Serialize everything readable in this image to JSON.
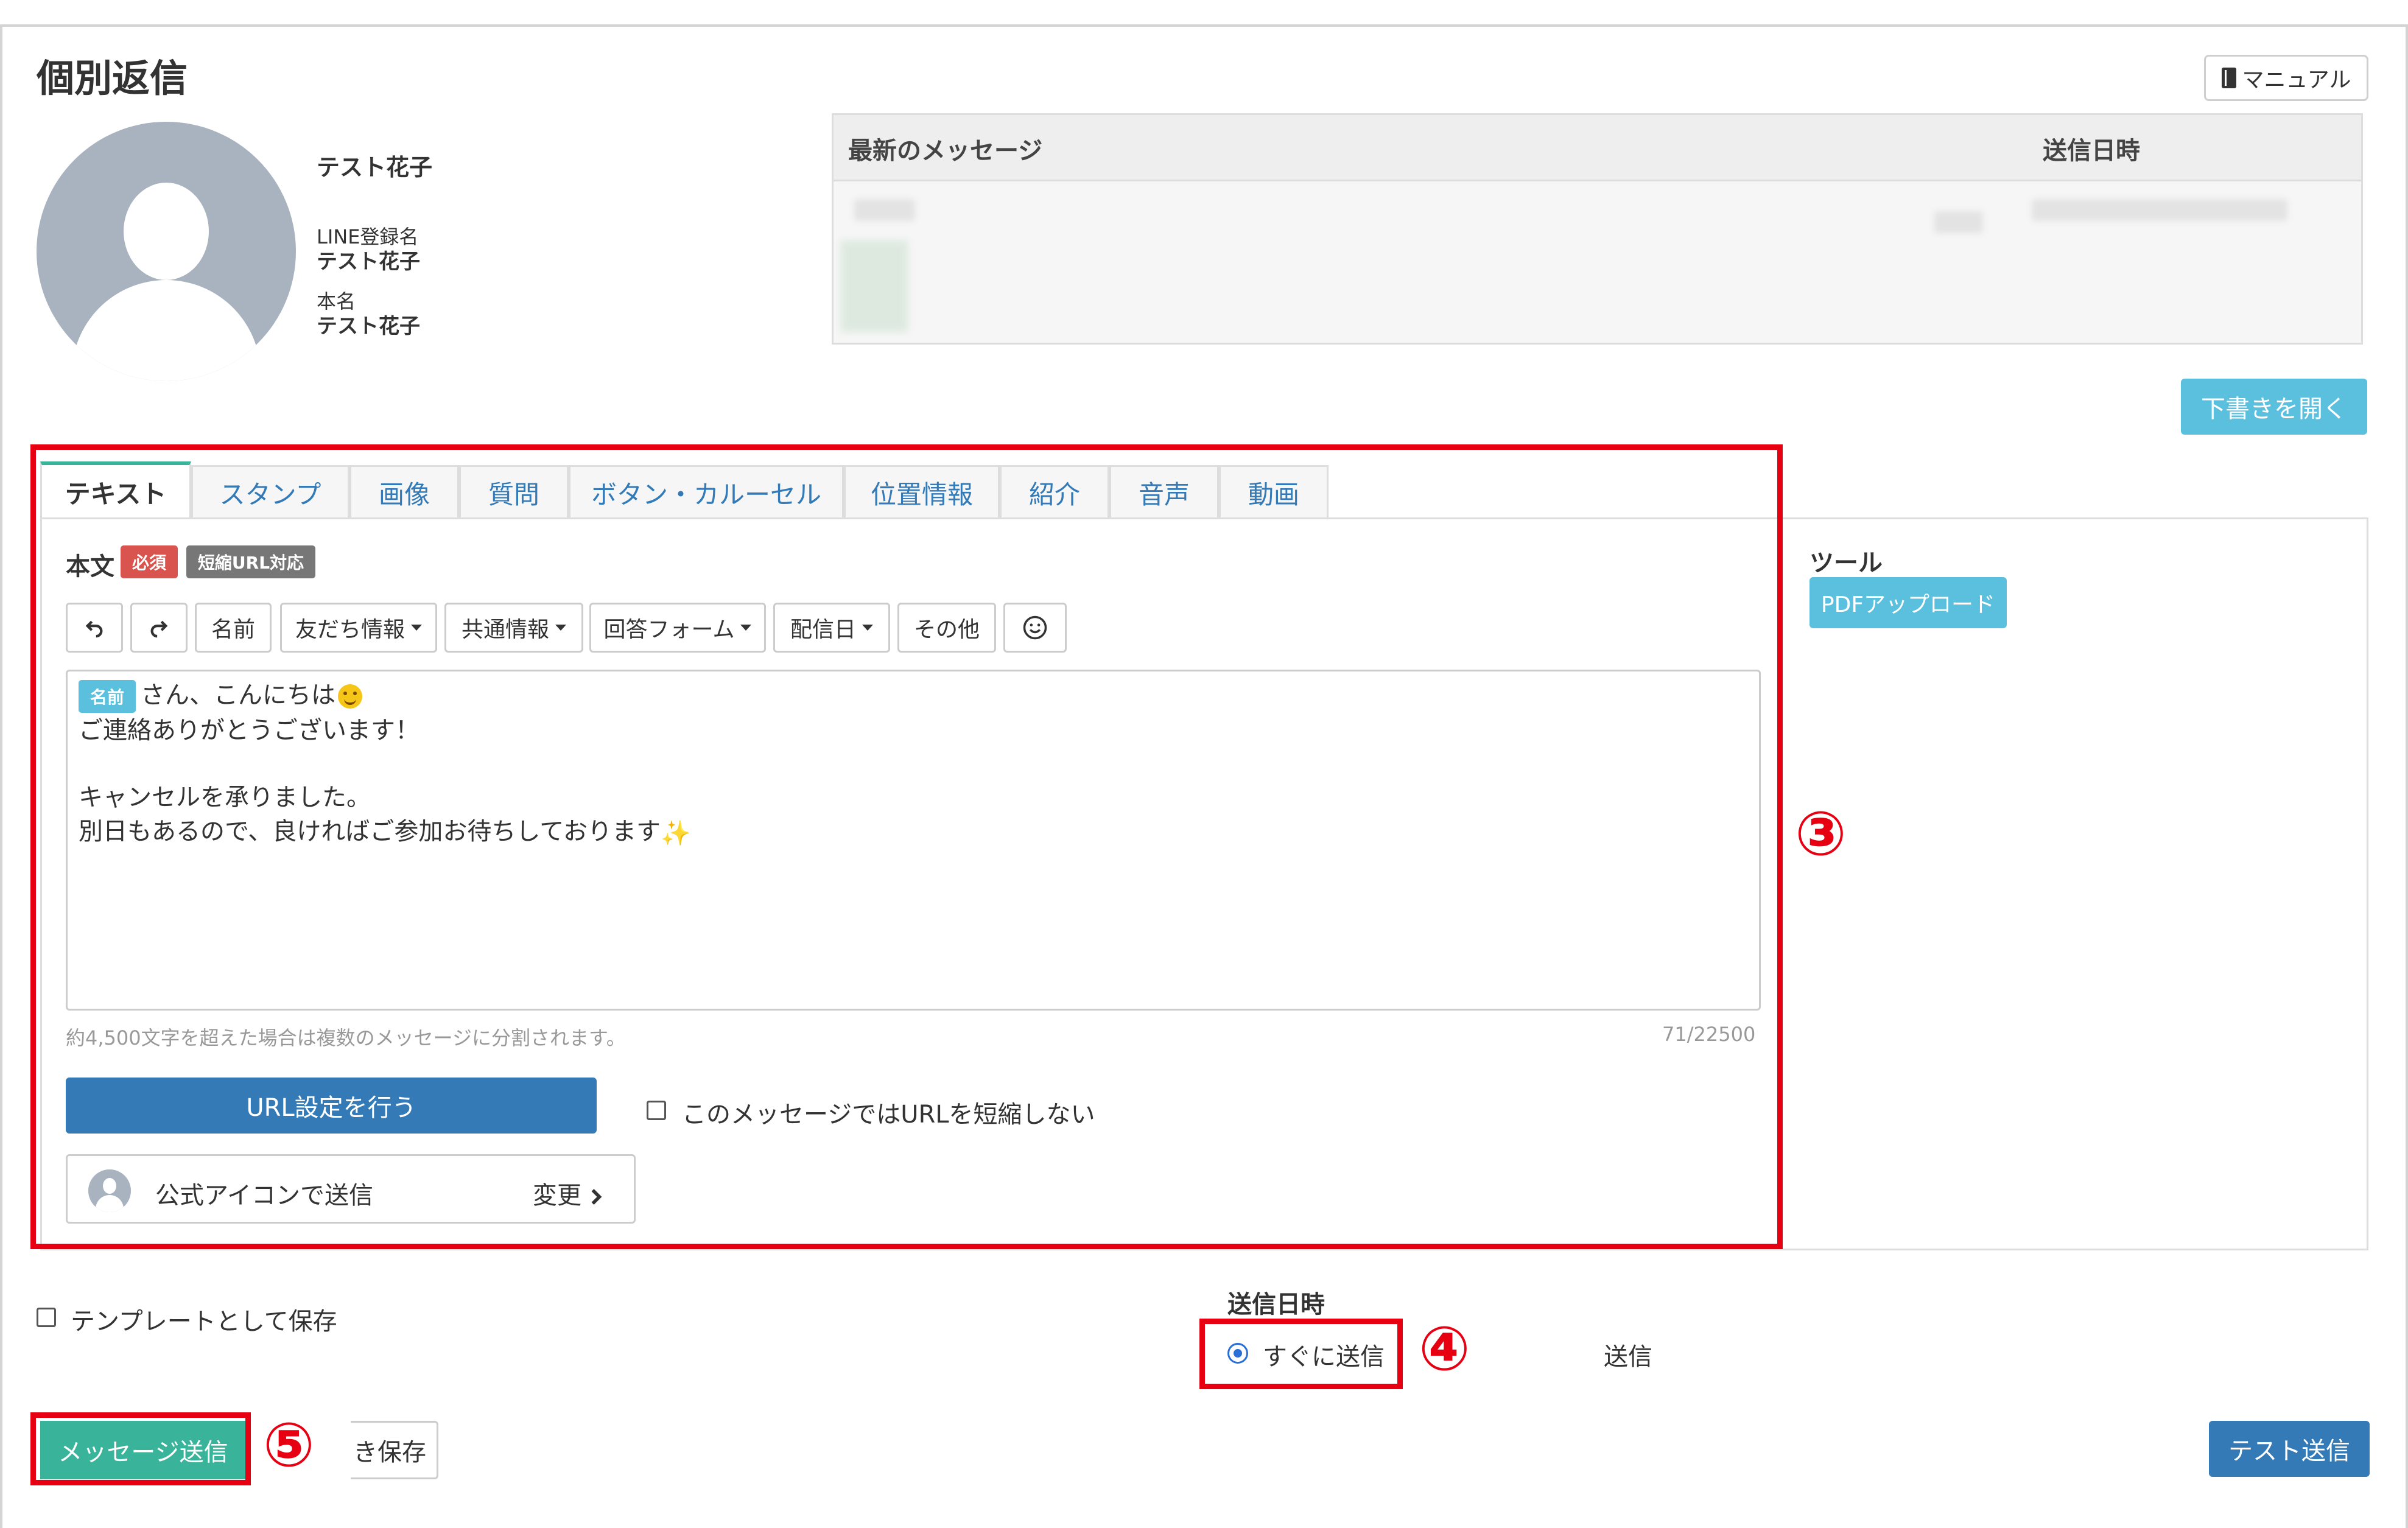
{
  "page": {
    "title": "個別返信",
    "manual_label": "マニュアル"
  },
  "user": {
    "display_name": "テスト花子",
    "line_label": "LINE登録名",
    "line_name": "テスト花子",
    "real_label": "本名",
    "real_name": "テスト花子"
  },
  "latest": {
    "col_message": "最新のメッセージ",
    "col_sent_at": "送信日時"
  },
  "draft_label": "下書きを開く",
  "tabs": [
    {
      "label": "テキスト",
      "active": true
    },
    {
      "label": "スタンプ"
    },
    {
      "label": "画像"
    },
    {
      "label": "質問"
    },
    {
      "label": "ボタン・カルーセル"
    },
    {
      "label": "位置情報"
    },
    {
      "label": "紹介"
    },
    {
      "label": "音声"
    },
    {
      "label": "動画"
    }
  ],
  "body": {
    "label": "本文",
    "required_badge": "必須",
    "short_url_badge": "短縮URL対応",
    "toolbar": {
      "undo": "undo-icon",
      "redo": "redo-icon",
      "name": "名前",
      "friend_info": "友だち情報",
      "common_info": "共通情報",
      "answer_form": "回答フォーム",
      "delivery_date": "配信日",
      "other": "その他",
      "emoji": "emoji-icon"
    },
    "name_chip": "名前",
    "lines": [
      "さん、こんにちは",
      "ご連絡ありがとうございます！",
      "キャンセルを承りました。",
      "別日もあるので、良ければご参加お待ちしております"
    ],
    "hint": "約4,500文字を超えた場合は複数のメッセージに分割されます。",
    "counter": "71/22500"
  },
  "url_settings_label": "URL設定を行う",
  "no_shorten_label": "このメッセージではURLを短縮しない",
  "sender": {
    "label": "公式アイコンで送信",
    "change_label": "変更"
  },
  "tools": {
    "title": "ツール",
    "pdf_upload": "PDFアップロード"
  },
  "markers": {
    "m3": "③",
    "m4": "④",
    "m5": "⑤"
  },
  "template_label": "テンプレートとして保存",
  "send_time": {
    "title": "送信日時",
    "now_label": "すぐに送信",
    "scheduled_label": "送信"
  },
  "actions": {
    "send": "メッセージ送信",
    "save": "き保存",
    "test_send": "テスト送信"
  },
  "colors": {
    "accent_green": "#39b49a",
    "primary_blue": "#337ab7",
    "info_blue": "#5bc0de",
    "danger_red": "#d9534f",
    "annotation_red": "#e60012"
  }
}
